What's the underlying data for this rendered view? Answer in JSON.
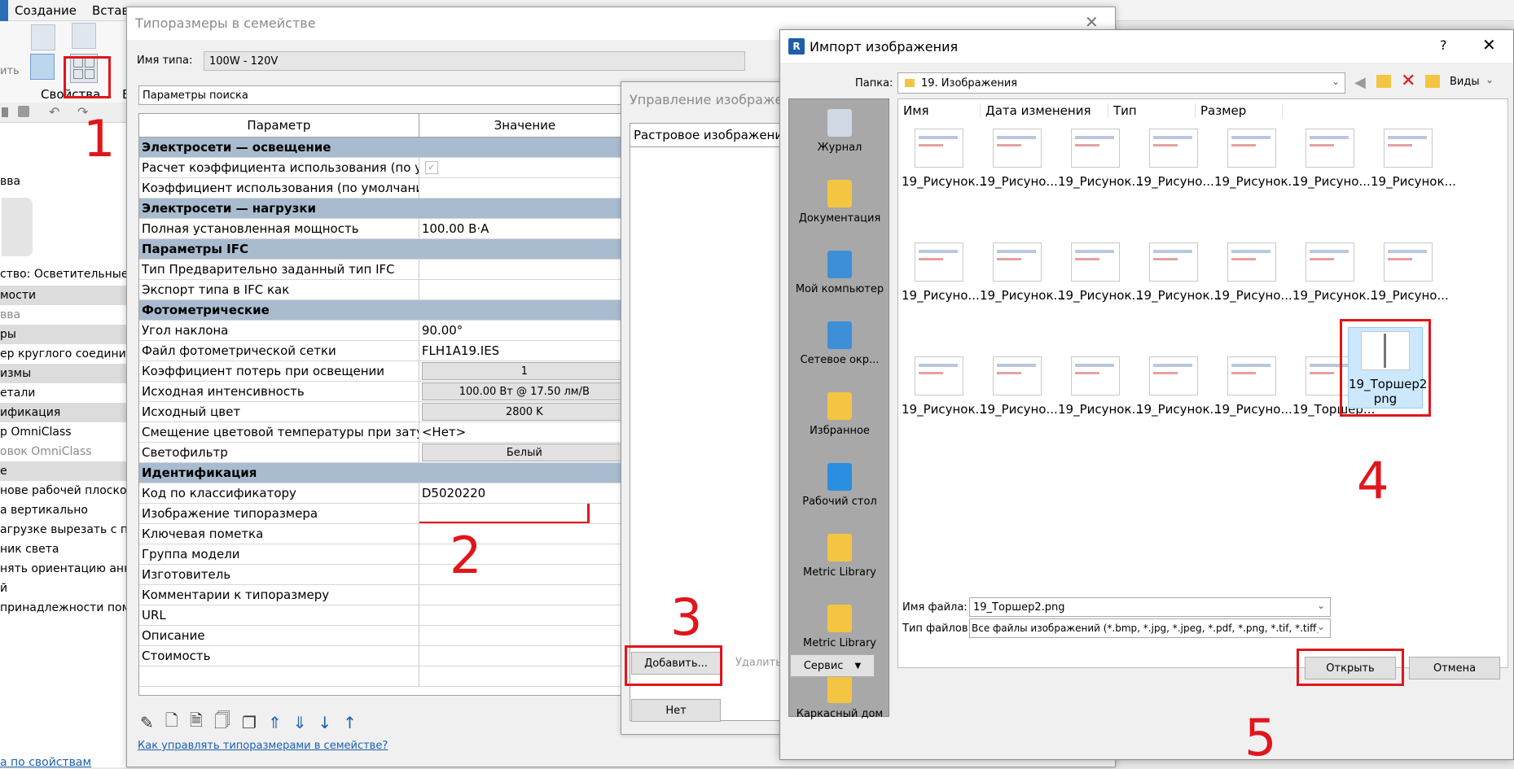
{
  "ribbon": {
    "tabs": [
      "Создание",
      "Вставка"
    ],
    "properties_label": "Свойства",
    "cut_label": "ить"
  },
  "left_panel": {
    "items": [
      "вва",
      "ство: Осветительные п",
      "мости",
      "вва",
      "ры",
      "ер круглого соедините",
      "измы",
      "етали",
      "ификация",
      "р OmniClass",
      "овок OmniClass",
      "е",
      "нове рабочей плоскос",
      "а вертикально",
      "агрузке вырезать с по",
      "ник света",
      "нять ориентацию анн",
      "й",
      "принадлежности пом"
    ],
    "bottom_link": "а по свойствам"
  },
  "family_types": {
    "title": "Типоразмеры в семействе",
    "type_name_label": "Имя типа:",
    "type_name_value": "100W - 120V",
    "search_placeholder": "Параметры поиска",
    "col_param": "Параметр",
    "col_value": "Значение",
    "rows": [
      {
        "group": true,
        "name": "Электросети — освещение"
      },
      {
        "name": "Расчет коэффициента использования (по умолч",
        "value": "",
        "check": true
      },
      {
        "name": "Коэффициент использования (по умолчанию)",
        "value": ""
      },
      {
        "group": true,
        "name": "Электросети — нагрузки"
      },
      {
        "name": "Полная установленная мощность",
        "value": "100.00 В·А"
      },
      {
        "group": true,
        "name": "Параметры IFC"
      },
      {
        "name": "Тип Предварительно заданный тип IFC",
        "value": ""
      },
      {
        "name": "Экспорт типа в IFC как",
        "value": ""
      },
      {
        "group": true,
        "name": "Фотометрические"
      },
      {
        "name": "Угол наклона",
        "value": "90.00°"
      },
      {
        "name": "Файл фотометрической сетки",
        "value": "FLH1A19.IES"
      },
      {
        "name": "Коэффициент потерь при освещении",
        "value": "1",
        "button": true
      },
      {
        "name": "Исходная интенсивность",
        "value": "100.00 Вт @ 17.50 лм/В",
        "button": true
      },
      {
        "name": "Исходный цвет",
        "value": "2800 K",
        "button": true
      },
      {
        "name": "Смещение цветовой температуры при затухани",
        "value": "<Нет>"
      },
      {
        "name": "Светофильтр",
        "value": "Белый",
        "button": true
      },
      {
        "group": true,
        "name": "Идентификация"
      },
      {
        "name": "Код по классификатору",
        "value": "D5020220"
      },
      {
        "name": "Изображение типоразмера",
        "value": "",
        "highlight": true
      },
      {
        "name": "Ключевая пометка",
        "value": ""
      },
      {
        "name": "Группа модели",
        "value": ""
      },
      {
        "name": "Изготовитель",
        "value": ""
      },
      {
        "name": "Комментарии к типоразмеру",
        "value": ""
      },
      {
        "name": "URL",
        "value": ""
      },
      {
        "name": "Описание",
        "value": ""
      },
      {
        "name": "Стоимость",
        "value": ""
      },
      {
        "name": "",
        "value": ""
      }
    ],
    "help_link": "Как управлять типоразмерами в семействе?"
  },
  "image_manager": {
    "title": "Управление изображения",
    "col_raster": "Растровое изображение",
    "add_button": "Добавить...",
    "delete_button": "Удалить",
    "none_button": "Нет"
  },
  "import_dialog": {
    "title": "Импорт изображения",
    "help": "?",
    "folder_label": "Папка:",
    "folder_value": "19. Изображения",
    "views_label": "Виды",
    "columns": [
      "Имя",
      "Дата изменения",
      "Тип",
      "Размер"
    ],
    "places": [
      "Журнал",
      "Документация",
      "Мой компьютер",
      "Сетевое окр...",
      "Избранное",
      "Рабочий стол",
      "Metric Library",
      "Metric Library",
      "Каркасный дом"
    ],
    "files_row1": [
      "19_Рисунок...",
      "19_Рисуно...",
      "19_Рисунок...",
      "19_Рисуно...",
      "19_Рисунок...",
      "19_Рисуно...",
      "19_Рисунок..."
    ],
    "files_row2": [
      "19_Рисуно...",
      "19_Рисунок...",
      "19_Рисунок...",
      "19_Рисунок...",
      "19_Рисуно...",
      "19_Рисунок...",
      "19_Рисуно..."
    ],
    "files_row3": [
      "19_Рисунок...",
      "19_Рисуно...",
      "19_Рисунок...",
      "19_Рисунок...",
      "19_Рисуно...",
      "19_Торшер..."
    ],
    "selected_file_line1": "19_Торшер2.",
    "selected_file_line2": "png",
    "filename_label": "Имя файла:",
    "filename_value": "19_Торшер2.png",
    "filetype_label": "Тип файлов:",
    "filetype_value": "Все файлы изображений  (*.bmp, *.jpg, *.jpeg, *.pdf, *.png, *.tif, *.tiff)",
    "service_button": "Сервис",
    "open_button": "Открыть",
    "cancel_button": "Отмена"
  },
  "annotations": [
    "1",
    "2",
    "3",
    "4",
    "5"
  ],
  "colors": {
    "accent": "#e0161b",
    "group_row": "#a9bccf",
    "places_bg": "#a8a8a8",
    "selected": "#cce8ff"
  }
}
